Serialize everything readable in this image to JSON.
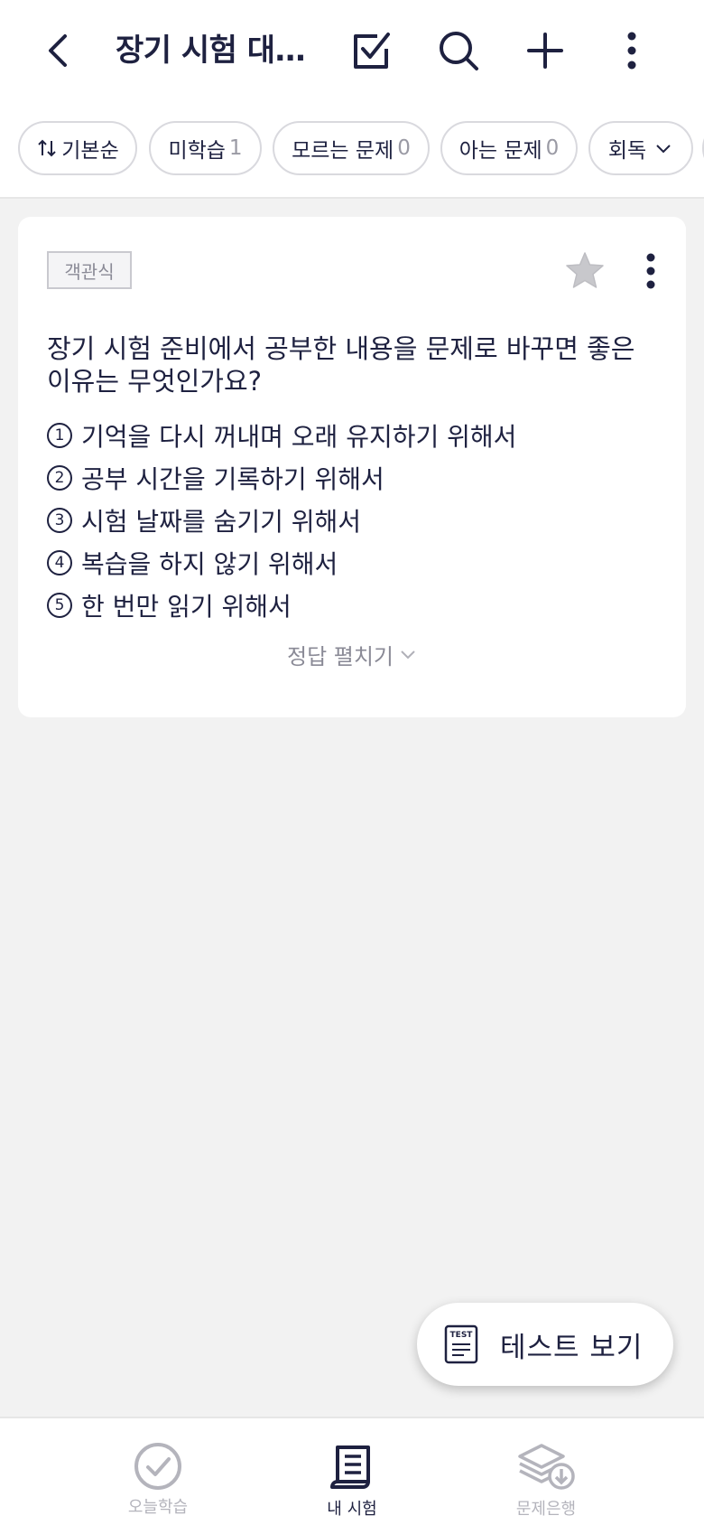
{
  "header": {
    "title": "장기 시험 대…",
    "icons": [
      "back-icon",
      "checklist-icon",
      "search-icon",
      "add-icon",
      "more-vertical-icon"
    ]
  },
  "filters": [
    {
      "label": "기본순",
      "icon": "sort-icon"
    },
    {
      "label": "미학습",
      "count": "1"
    },
    {
      "label": "모르는 문제",
      "count": "0"
    },
    {
      "label": "아는 문제",
      "count": "0"
    },
    {
      "label": "회독",
      "icon": "chevron-down-icon"
    }
  ],
  "card": {
    "tag": "객관식",
    "question": "장기 시험 준비에서 공부한 내용을 문제로 바꾸면 좋은 이유는 무엇인가요?",
    "options": [
      {
        "num": "1",
        "text": "기억을 다시 꺼내며 오래 유지하기 위해서"
      },
      {
        "num": "2",
        "text": "공부 시간을 기록하기 위해서"
      },
      {
        "num": "3",
        "text": "시험 날짜를 숨기기 위해서"
      },
      {
        "num": "4",
        "text": "복습을 하지 않기 위해서"
      },
      {
        "num": "5",
        "text": "한 번만 읽기 위해서"
      }
    ],
    "reveal_label": "정답 펼치기"
  },
  "fab": {
    "label": "테스트 보기",
    "icon_text": "TEST"
  },
  "bottom_nav": [
    {
      "label": "오늘학습",
      "icon": "check-circle-icon",
      "active": false
    },
    {
      "label": "내 시험",
      "icon": "notebook-icon",
      "active": true
    },
    {
      "label": "문제은행",
      "icon": "layers-download-icon",
      "active": false
    }
  ],
  "colors": {
    "primary": "#1e2140",
    "muted": "#9a9aa4",
    "background": "#f2f2f2"
  }
}
